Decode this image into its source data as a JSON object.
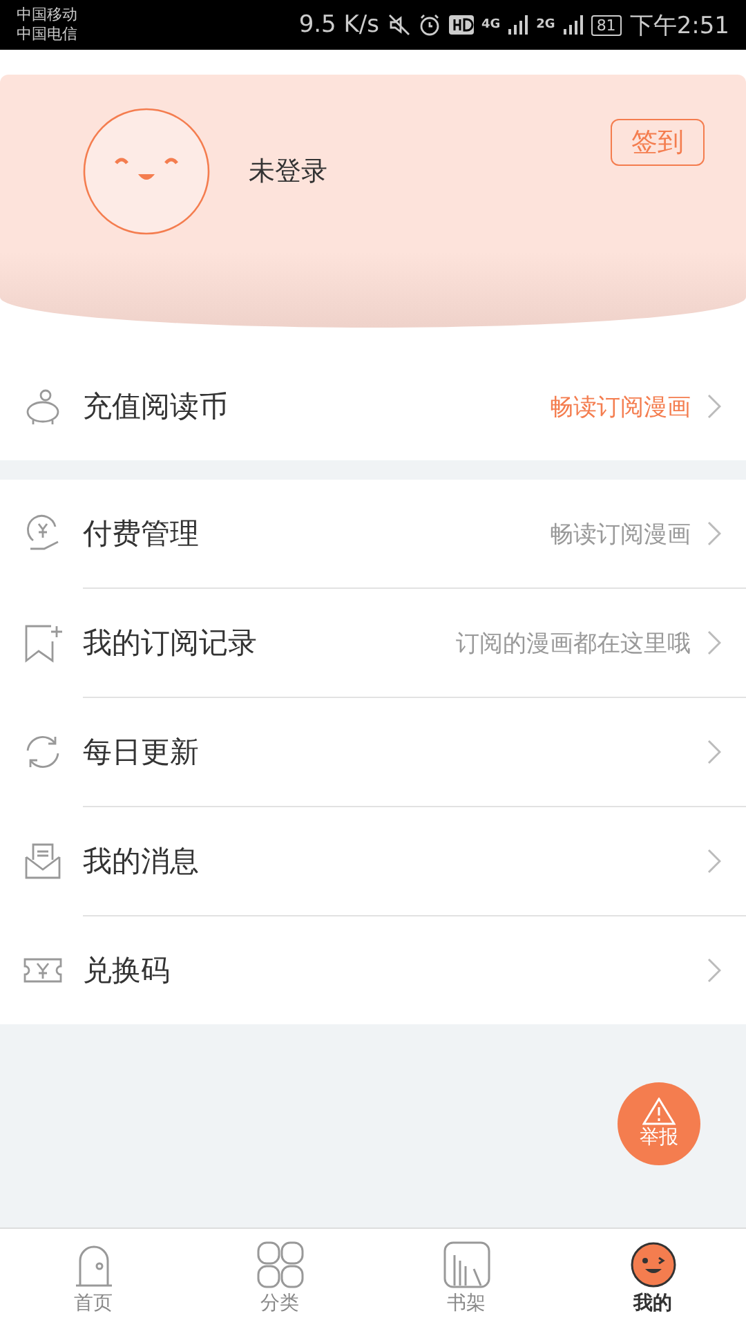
{
  "status_bar": {
    "carriers": [
      "中国移动",
      "中国电信"
    ],
    "speed": "9.5 K/s",
    "network_1": "4G",
    "network_2": "2G",
    "battery": "81",
    "time": "下午2:51"
  },
  "profile": {
    "name": "未登录",
    "checkin_button": "签到"
  },
  "sections": [
    {
      "items": [
        {
          "label": "充值阅读币",
          "detail": "畅读订阅漫画",
          "highlighted": true
        }
      ]
    },
    {
      "items": [
        {
          "label": "付费管理",
          "detail": "畅读订阅漫画",
          "highlighted": false
        },
        {
          "label": "我的订阅记录",
          "detail": "订阅的漫画都在这里哦",
          "highlighted": false
        },
        {
          "label": "每日更新"
        },
        {
          "label": "我的消息"
        },
        {
          "label": "兑换码"
        }
      ]
    }
  ],
  "report_button": "举报",
  "tabs": [
    {
      "label": "首页",
      "selected": false
    },
    {
      "label": "分类",
      "selected": false
    },
    {
      "label": "书架",
      "selected": false
    },
    {
      "label": "我的",
      "selected": true
    }
  ]
}
